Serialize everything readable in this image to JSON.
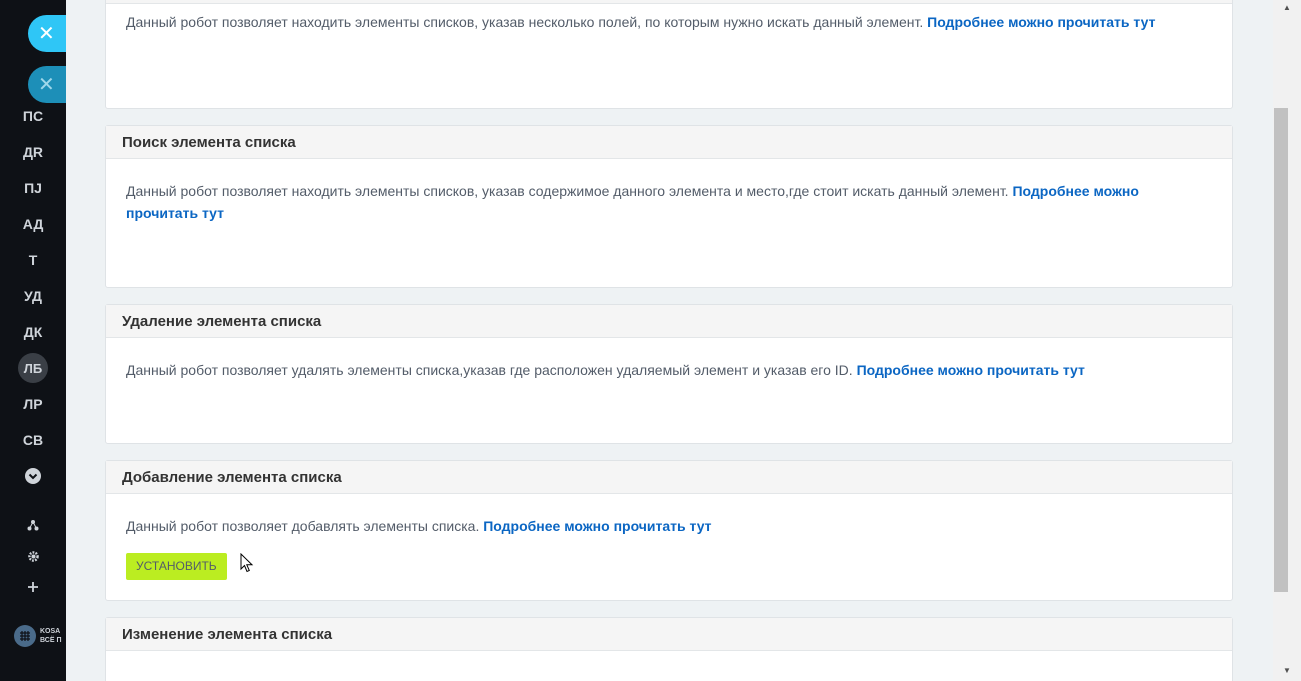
{
  "sidebar": {
    "items": [
      {
        "label": "ПС"
      },
      {
        "label": "ДR"
      },
      {
        "label": "ПJ"
      },
      {
        "label": "АД"
      },
      {
        "label": "Т"
      },
      {
        "label": "УД"
      },
      {
        "label": "ДК"
      },
      {
        "label": "ЛБ"
      },
      {
        "label": "ЛР"
      },
      {
        "label": "СВ"
      }
    ],
    "close_glyph": "✕",
    "logo_text": "KOSA\nВСЁ П"
  },
  "cards": [
    {
      "title": "",
      "text": "Данный робот позволяет находить элементы списков, указав несколько полей, по которым нужно искать данный элемент. ",
      "link": "Подробнее можно прочитать тут"
    },
    {
      "title": "Поиск элемента списка",
      "text": "Данный робот позволяет находить элементы списков, указав содержимое данного элемента и место,где стоит искать данный элемент. ",
      "link": "Подробнее можно прочитать тут"
    },
    {
      "title": "Удаление элемента списка",
      "text": "Данный робот позволяет удалять элементы списка,указав где расположен удаляемый элемент и указав его ID. ",
      "link": "Подробнее можно прочитать тут"
    },
    {
      "title": "Добавление элемента списка",
      "text": "Данный робот позволяет добавлять элементы списка. ",
      "link": "Подробнее можно прочитать тут",
      "button": "УСТАНОВИТЬ"
    },
    {
      "title": "Изменение элемента списка",
      "text": "",
      "link": ""
    }
  ],
  "colors": {
    "accent_link": "#0b66c3",
    "install_button": "#bbed21",
    "slider_close": "#2fc6f6"
  }
}
